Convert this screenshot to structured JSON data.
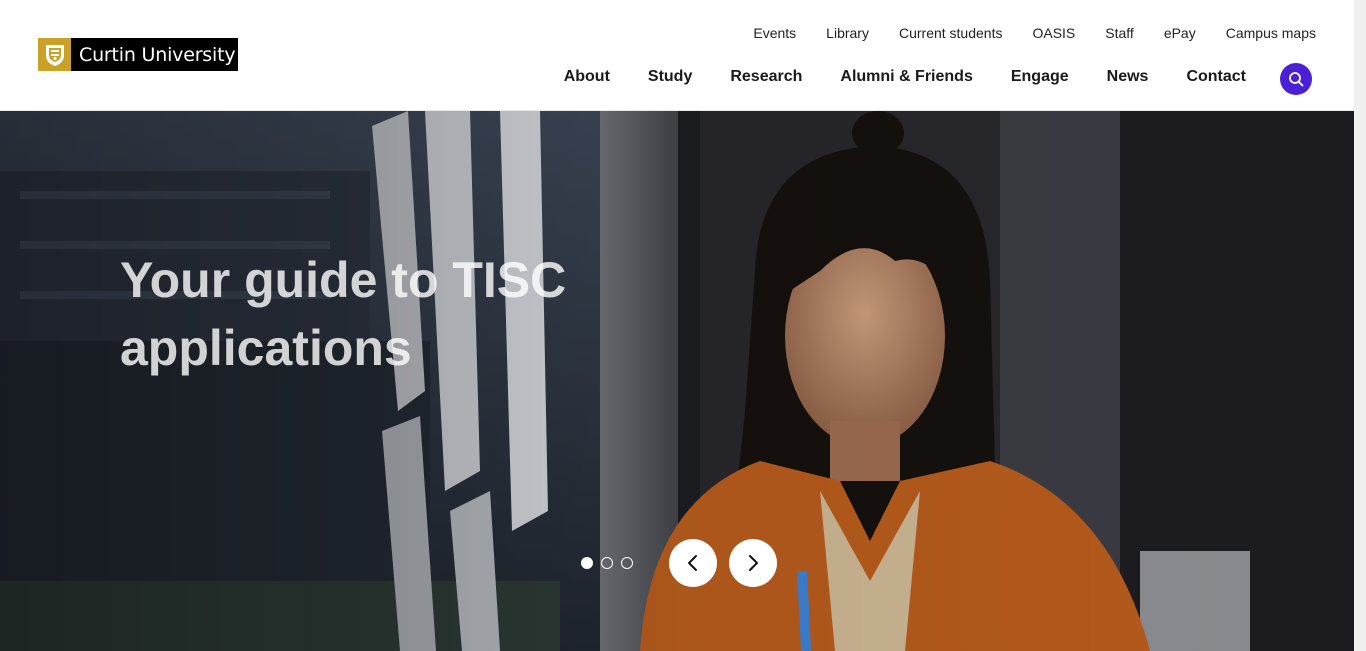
{
  "brand": {
    "name": "Curtin University",
    "crest_color": "#c9a227",
    "logo_bg": "#000000"
  },
  "utility_nav": {
    "items": [
      "Events",
      "Library",
      "Current students",
      "OASIS",
      "Staff",
      "ePay",
      "Campus maps"
    ]
  },
  "main_nav": {
    "items": [
      "About",
      "Study",
      "Research",
      "Alumni & Friends",
      "Engage",
      "News",
      "Contact"
    ]
  },
  "search": {
    "icon": "search-icon",
    "color": "#4a1fd6"
  },
  "hero": {
    "title": "Your guide to TISC applications",
    "slide_count": 3,
    "active_slide": 1,
    "prev_icon": "chevron-left-icon",
    "next_icon": "chevron-right-icon"
  }
}
